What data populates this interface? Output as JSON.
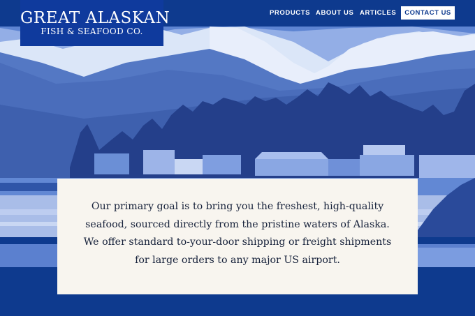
{
  "brand": {
    "line1": "GREAT ALASKAN",
    "line2": "FISH & SEAFOOD CO."
  },
  "nav": {
    "products": "PRODUCTS",
    "about": "ABOUT US",
    "articles": "ARTICLES",
    "contact": "CONTACT US"
  },
  "hero": {
    "description": "Our primary goal is to bring you the freshest, high-quality seafood, sourced directly from the pristine waters of Alaska. We offer standard to-your-door shipping or freight shipments for large orders to any major US airport."
  },
  "colors": {
    "brand_blue": "#0e3a8e",
    "card_bg": "#f8f5ef",
    "text_dark": "#16213a"
  }
}
